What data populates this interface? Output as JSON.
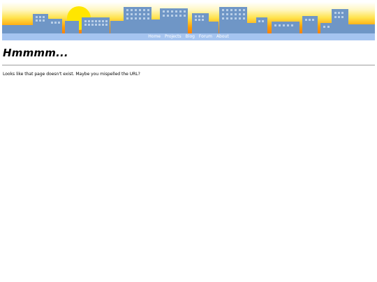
{
  "header": {
    "nav": [
      {
        "label": "Home"
      },
      {
        "label": "Projects"
      },
      {
        "label": "Blog"
      },
      {
        "label": "Forum"
      },
      {
        "label": "About"
      }
    ]
  },
  "main": {
    "title": "Hmmmm...",
    "message": "Looks like that page doesn't exist. Maybe you mispelled the URL?"
  },
  "colors": {
    "sky_top": "#ffffff",
    "sky_mid": "#ffe34d",
    "sky_bottom": "#ff8a00",
    "sun": "#ffe600",
    "building": "#6f96c6",
    "window": "#b9cfe8",
    "nav_bar": "#a5c4f0",
    "nav_text": "#ffffff"
  }
}
